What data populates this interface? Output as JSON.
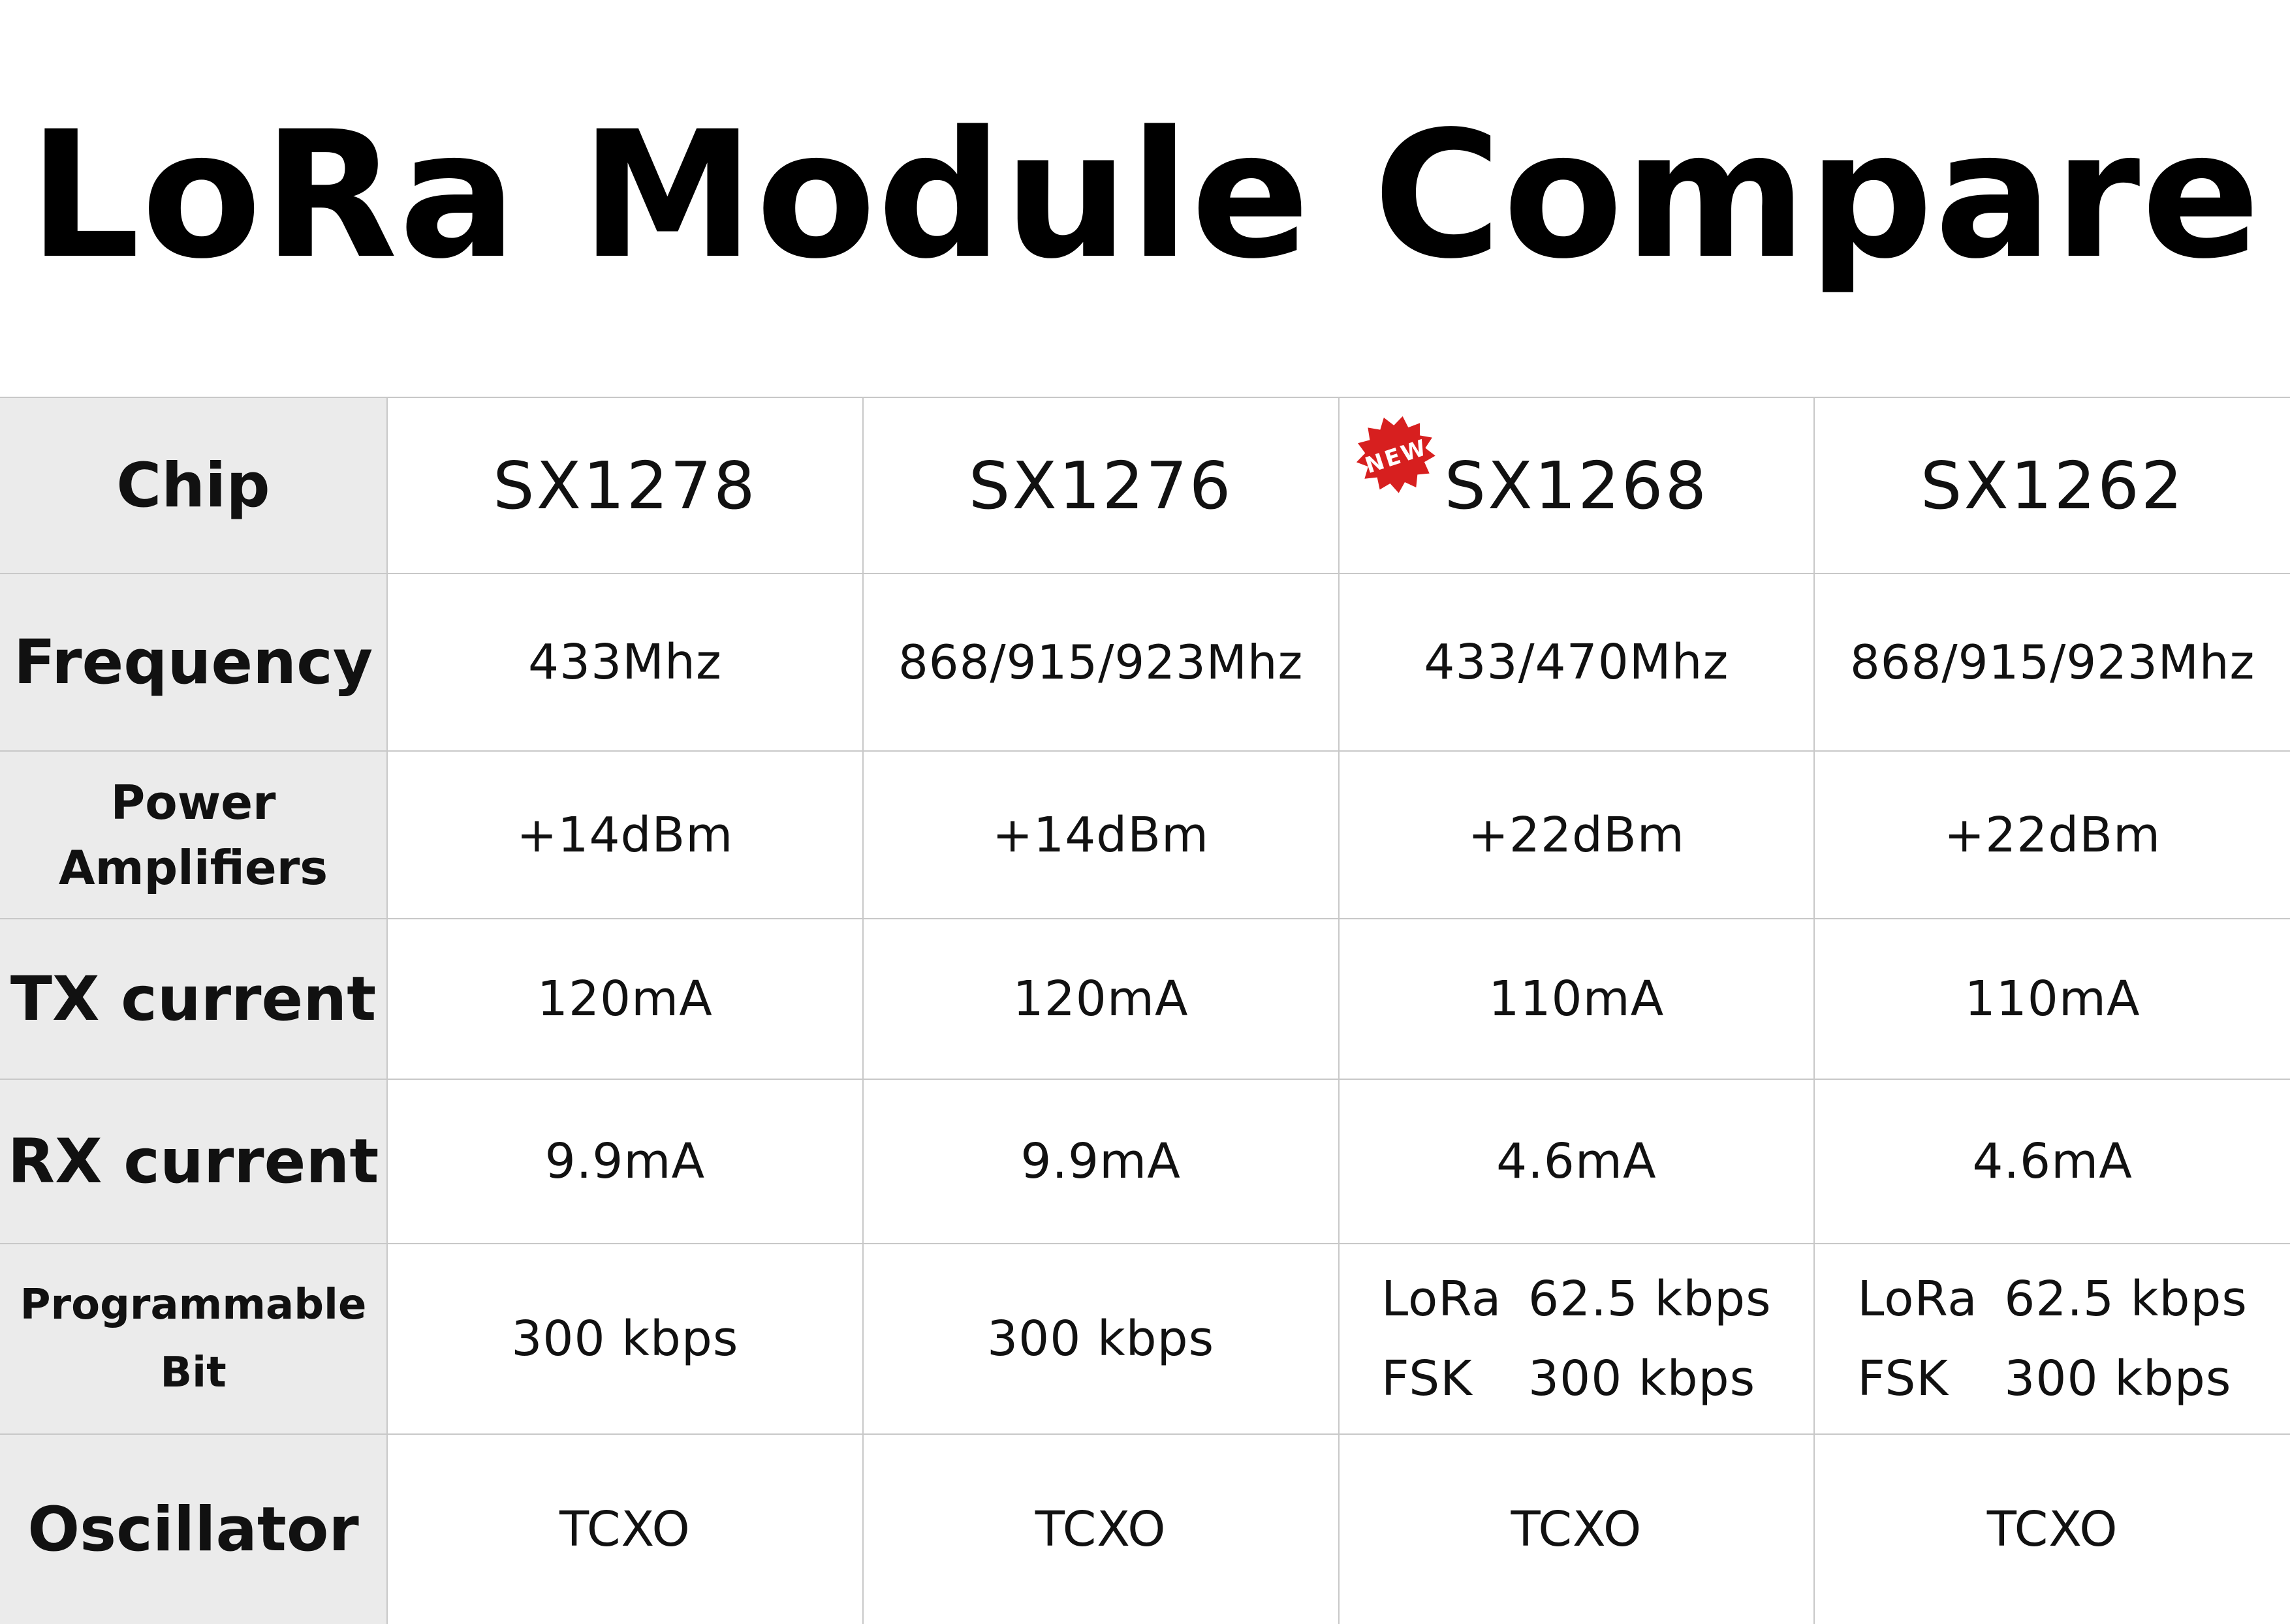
{
  "title": "LoRa Module Compare",
  "badge": {
    "text": "NEW",
    "color": "#d71f1f"
  },
  "rows": {
    "chip": {
      "label": "Chip",
      "values": [
        "SX1278",
        "SX1276",
        "SX1268",
        "SX1262"
      ]
    },
    "frequency": {
      "label": "Frequency",
      "values": [
        "433Mhz",
        "868/915/923Mhz",
        "433/470Mhz",
        "868/915/923Mhz"
      ]
    },
    "power_amplifiers": {
      "label_line1": "Power",
      "label_line2": "Amplifiers",
      "values": [
        "+14dBm",
        "+14dBm",
        "+22dBm",
        "+22dBm"
      ]
    },
    "tx_current": {
      "label": "TX current",
      "values": [
        "120mA",
        "120mA",
        "110mA",
        "110mA"
      ]
    },
    "rx_current": {
      "label": "RX current",
      "values": [
        "9.9mA",
        "9.9mA",
        "4.6mA",
        "4.6mA"
      ]
    },
    "programmable_bit": {
      "label_line1": "Programmable",
      "label_line2": "Bit",
      "values": [
        "300 kbps",
        "300 kbps"
      ],
      "sx1268": {
        "lora_label": "LoRa",
        "lora_value": "62.5 kbps",
        "fsk_label": "FSK",
        "fsk_value": "300 kbps"
      },
      "sx1262": {
        "lora_label": "LoRa",
        "lora_value": "62.5 kbps",
        "fsk_label": "FSK",
        "fsk_value": "300 kbps"
      }
    },
    "oscillator": {
      "label": "Oscillator",
      "values": [
        "TCXO",
        "TCXO",
        "TCXO",
        "TCXO"
      ]
    }
  }
}
